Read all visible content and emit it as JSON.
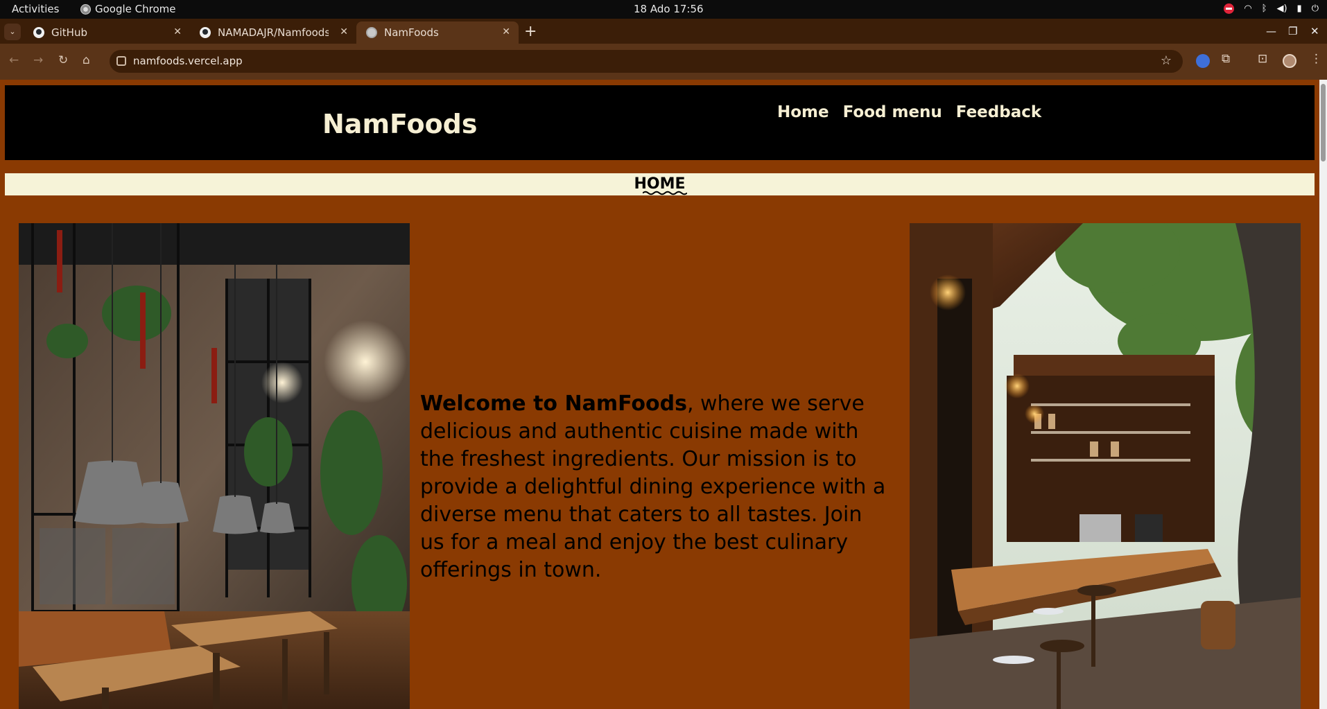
{
  "os": {
    "activities": "Activities",
    "app_name": "Google Chrome",
    "clock": "18 Ado  17:56"
  },
  "browser": {
    "tabs": [
      {
        "label": "GitHub",
        "icon": "github-icon",
        "active": false
      },
      {
        "label": "NAMADAJR/Namfoods:",
        "icon": "github-icon",
        "active": false
      },
      {
        "label": "NamFoods",
        "icon": "globe-icon",
        "active": true
      }
    ],
    "url": "namfoods.vercel.app"
  },
  "site": {
    "brand": "NamFoods",
    "nav": [
      "Home",
      "Food menu",
      "Feedback"
    ],
    "banner_title": "HOME",
    "intro_strong": "Welcome to NamFoods",
    "intro_rest": ", where we serve delicious and authentic cuisine made with the freshest ingredients. Our mission is to provide a delightful dining experience with a diverse menu that caters to all tastes. Join us for a meal and enjoy the best culinary offerings in town."
  },
  "colors": {
    "page_bg": "#8a3a02",
    "header_bg": "#000000",
    "banner_bg": "#f6f3d8",
    "brand_text": "#f6efd3"
  }
}
